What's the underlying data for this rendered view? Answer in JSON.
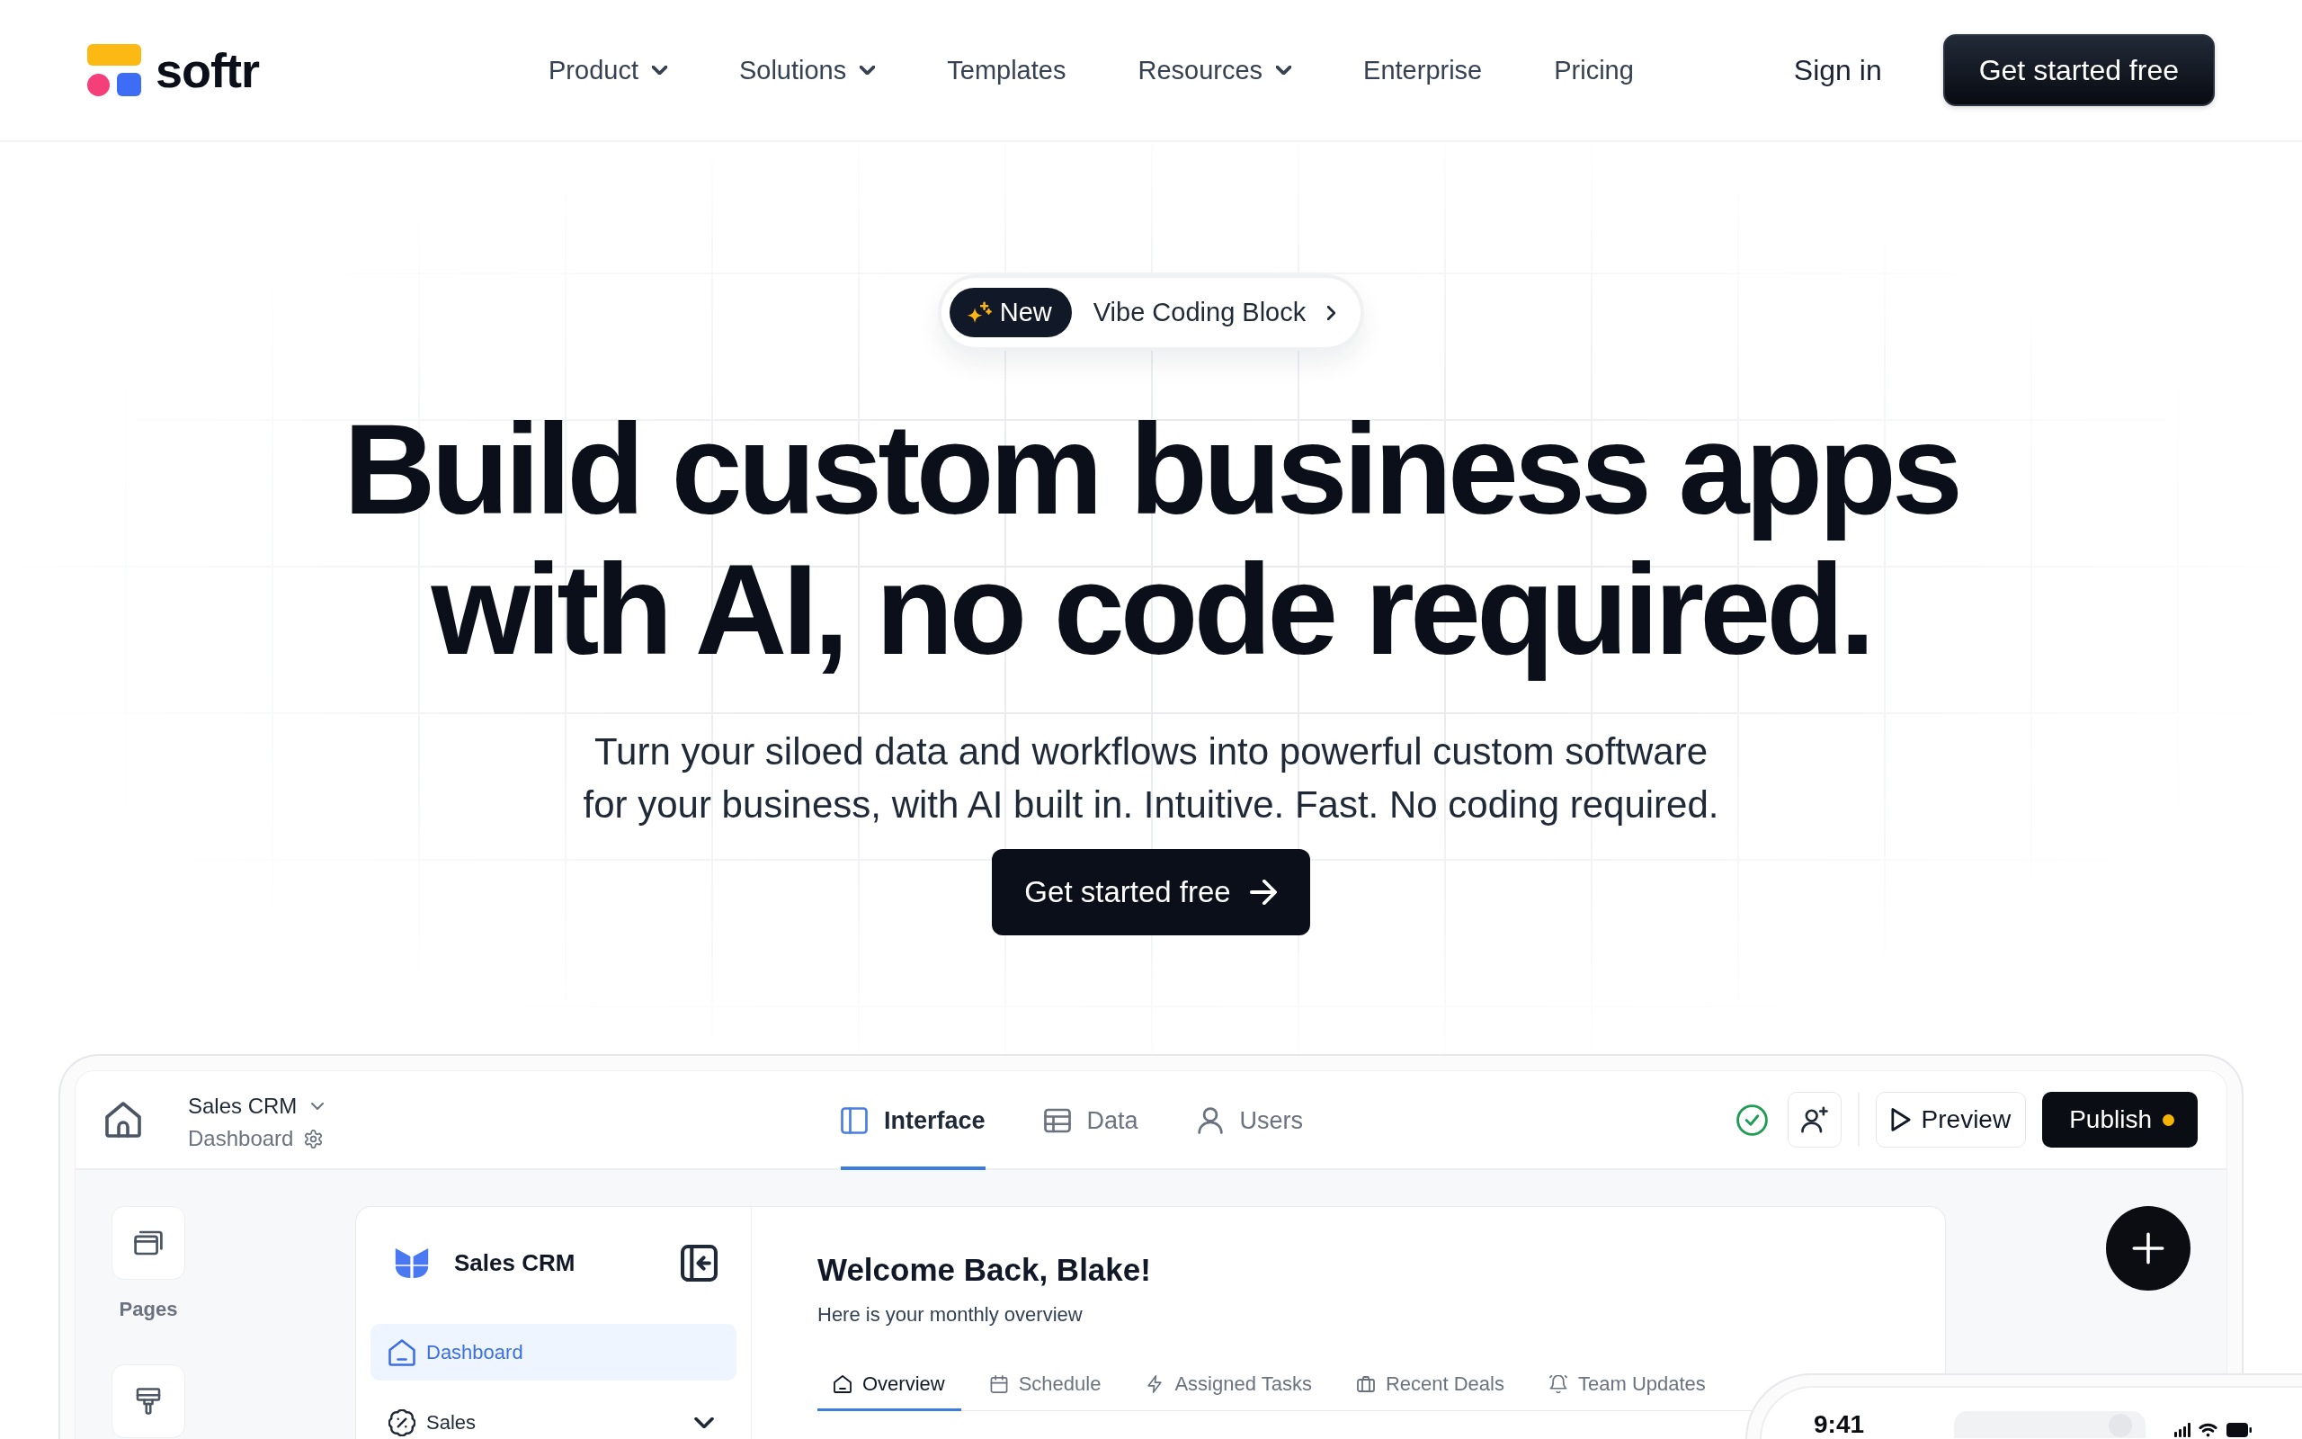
{
  "header": {
    "logo": "softr",
    "nav": [
      {
        "label": "Product",
        "dropdown": true
      },
      {
        "label": "Solutions",
        "dropdown": true
      },
      {
        "label": "Templates",
        "dropdown": false
      },
      {
        "label": "Resources",
        "dropdown": true
      },
      {
        "label": "Enterprise",
        "dropdown": false
      },
      {
        "label": "Pricing",
        "dropdown": false
      }
    ],
    "sign_in": "Sign in",
    "cta": "Get started free"
  },
  "hero": {
    "badge": {
      "tag": "New",
      "label": "Vibe Coding Block"
    },
    "title": "Build custom business apps with AI, no code required.",
    "subtitle": "Turn your siloed data and workflows into powerful custom software for your business, with AI built in. Intuitive. Fast. No coding required.",
    "cta": "Get started free"
  },
  "app_preview": {
    "topbar": {
      "app_name": "Sales CRM",
      "page": "Dashboard",
      "tabs": [
        {
          "label": "Interface",
          "selected": true
        },
        {
          "label": "Data",
          "selected": false
        },
        {
          "label": "Users",
          "selected": false
        }
      ],
      "synced": true,
      "preview": "Preview",
      "publish": "Publish",
      "unpublished_changes": true
    },
    "rail": {
      "pages_label": "Pages"
    },
    "sidebar": {
      "app_name": "Sales CRM",
      "items": [
        {
          "label": "Dashboard",
          "kind": "link",
          "selected": true
        },
        {
          "label": "Sales",
          "kind": "group",
          "selected": false
        }
      ]
    },
    "main": {
      "greeting": "Welcome Back, Blake!",
      "subtitle": "Here is your monthly overview",
      "tabs": [
        {
          "label": "Overview",
          "selected": true
        },
        {
          "label": "Schedule",
          "selected": false
        },
        {
          "label": "Assigned Tasks",
          "selected": false
        },
        {
          "label": "Recent Deals",
          "selected": false
        },
        {
          "label": "Team Updates",
          "selected": false
        }
      ]
    },
    "phone": {
      "time": "9:41"
    }
  }
}
